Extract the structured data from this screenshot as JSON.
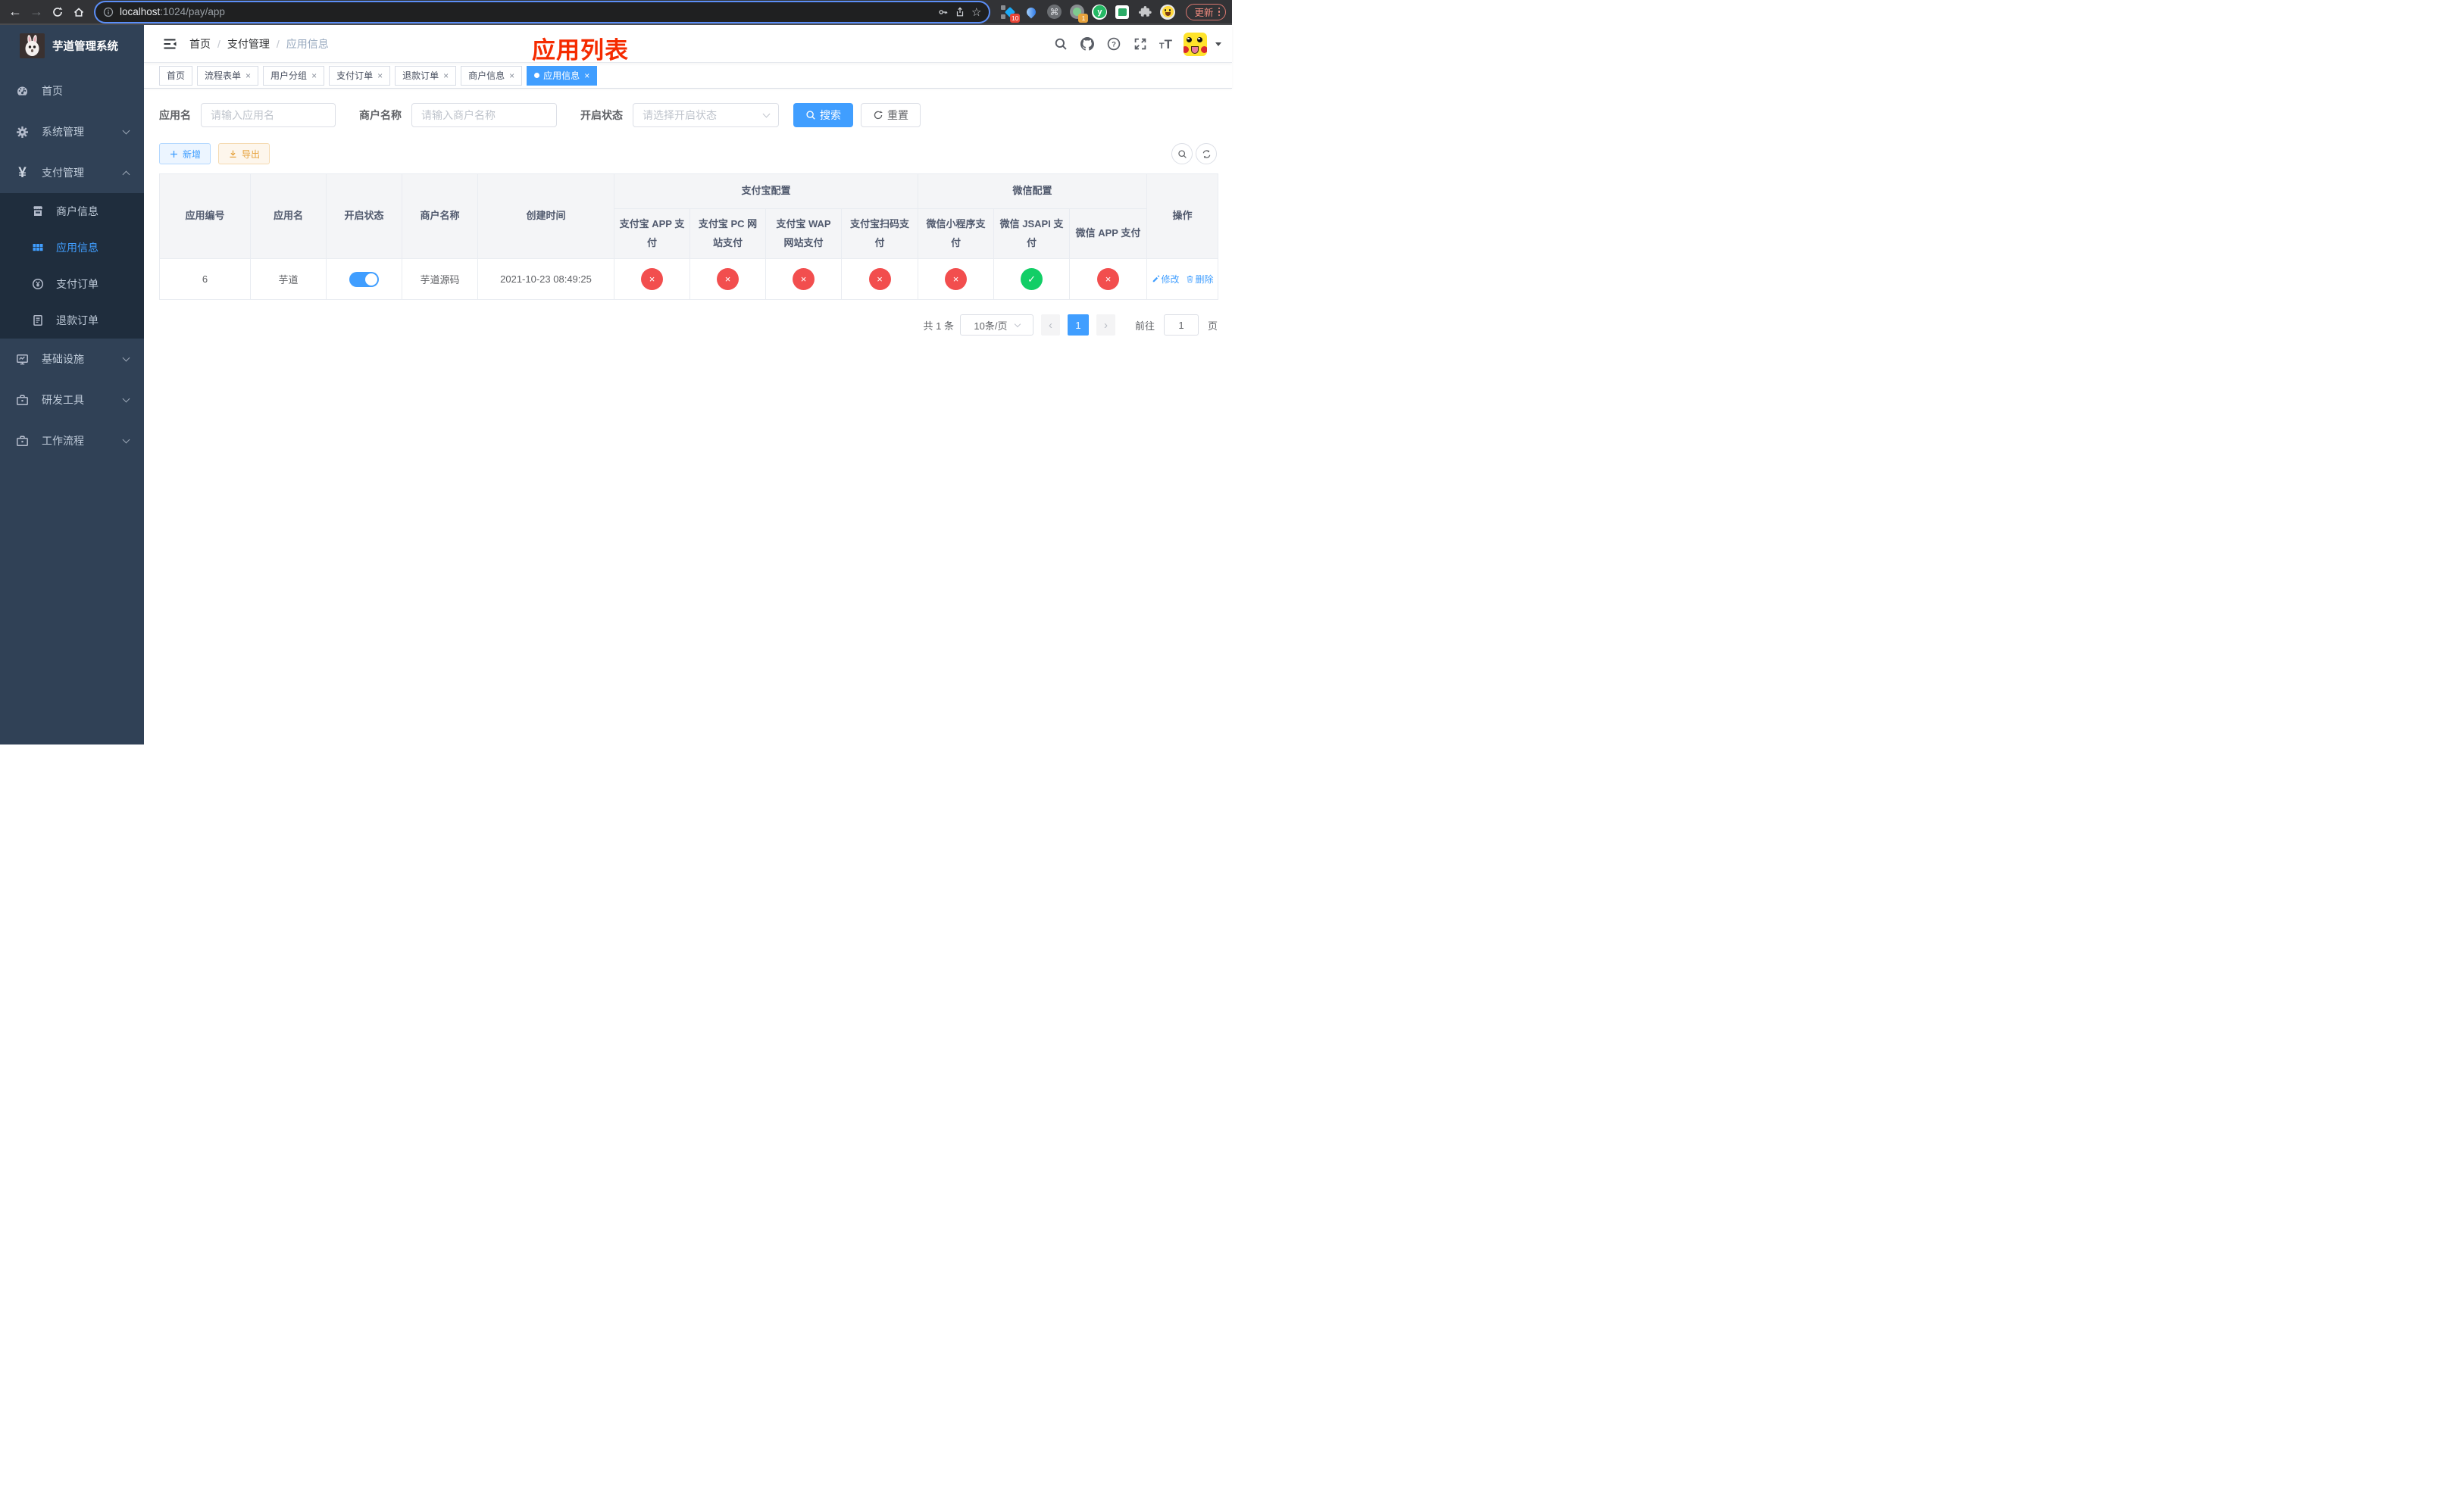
{
  "browser": {
    "url_host": "localhost",
    "url_path": ":1024/pay/app",
    "ext_badge_1": "10",
    "ext_badge_2": "1",
    "command_glyph": "⌘",
    "yuque_glyph": "y",
    "update_button": "更新"
  },
  "sidebar": {
    "logo_title": "芋道管理系统",
    "items": [
      {
        "label": "首页"
      },
      {
        "label": "系统管理"
      },
      {
        "label": "支付管理"
      },
      {
        "label": "商户信息"
      },
      {
        "label": "应用信息"
      },
      {
        "label": "支付订单"
      },
      {
        "label": "退款订单"
      },
      {
        "label": "基础设施"
      },
      {
        "label": "研发工具"
      },
      {
        "label": "工作流程"
      }
    ]
  },
  "navbar": {
    "breadcrumb": [
      "首页",
      "支付管理",
      "应用信息"
    ],
    "page_title": "应用列表"
  },
  "tabs": [
    {
      "label": "首页"
    },
    {
      "label": "流程表单"
    },
    {
      "label": "用户分组"
    },
    {
      "label": "支付订单"
    },
    {
      "label": "退款订单"
    },
    {
      "label": "商户信息"
    },
    {
      "label": "应用信息"
    }
  ],
  "filters": {
    "app_name_label": "应用名",
    "app_name_placeholder": "请输入应用名",
    "merchant_label": "商户名称",
    "merchant_placeholder": "请输入商户名称",
    "status_label": "开启状态",
    "status_placeholder": "请选择开启状态",
    "search_button": "搜索",
    "reset_button": "重置"
  },
  "toolbar": {
    "add_button": "新增",
    "export_button": "导出"
  },
  "table": {
    "columns": [
      "应用编号",
      "应用名",
      "开启状态",
      "商户名称",
      "创建时间"
    ],
    "group_alipay": "支付宝配置",
    "group_wechat": "微信配置",
    "sub_columns": [
      "支付宝 APP 支付",
      "支付宝 PC 网站支付",
      "支付宝 WAP 网站支付",
      "支付宝扫码支付",
      "微信小程序支付",
      "微信 JSAPI 支付",
      "微信 APP 支付"
    ],
    "actions_column": "操作",
    "row": {
      "id": "6",
      "name": "芋道",
      "enabled": true,
      "merchant": "芋道源码",
      "created": "2021-10-23 08:49:25",
      "channels": [
        "no",
        "no",
        "no",
        "no",
        "no",
        "yes",
        "no"
      ],
      "edit_label": "修改",
      "delete_label": "删除"
    }
  },
  "pagination": {
    "total": "共 1 条",
    "page_size": "10条/页",
    "current_page": "1",
    "goto_label": "前往",
    "goto_value": "1",
    "page_unit": "页"
  },
  "colors": {
    "accent": "#409eff",
    "title_red": "#f52b00",
    "status_off": "#f24e4e",
    "status_on": "#12ce66",
    "sidebar_bg": "#304156",
    "submenu_bg": "#1f2d3d"
  }
}
